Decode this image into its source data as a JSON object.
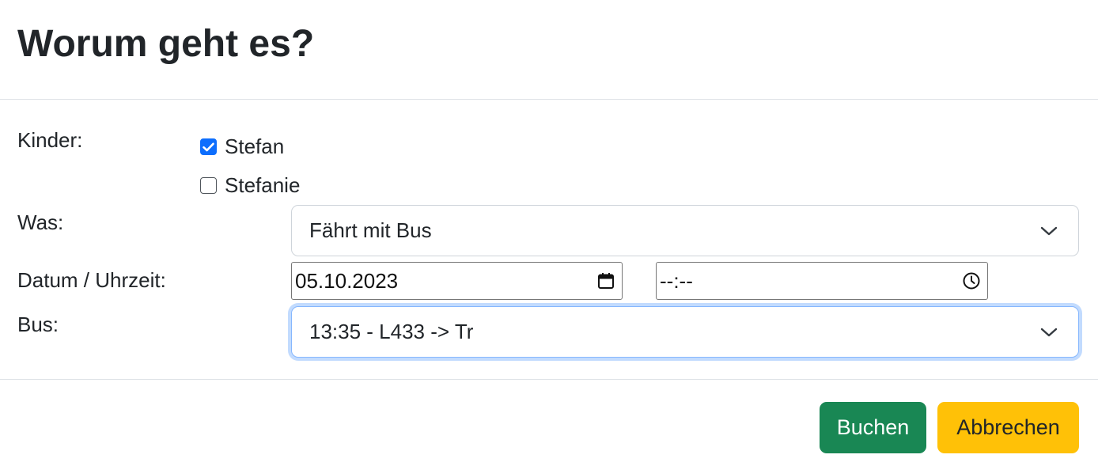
{
  "modal": {
    "title": "Worum geht es?"
  },
  "form": {
    "children": {
      "label": "Kinder:",
      "options": [
        {
          "label": "Stefan",
          "checked": true
        },
        {
          "label": "Stefanie",
          "checked": false
        }
      ]
    },
    "what": {
      "label": "Was:",
      "selected": "Fährt mit Bus"
    },
    "datetime": {
      "label": "Datum / Uhrzeit:",
      "date_value": "05.10.2023",
      "time_value": "--:--"
    },
    "bus": {
      "label": "Bus:",
      "selected": "13:35 - L433 -> Tr"
    }
  },
  "footer": {
    "book_label": "Buchen",
    "cancel_label": "Abbrechen"
  },
  "colors": {
    "primary": "#0d6efd",
    "success": "#198754",
    "warning": "#ffc107",
    "focus_ring": "#86b7fe"
  },
  "icons": {
    "checkbox_checked": "checkmark-icon",
    "select_chevron": "chevron-down-icon",
    "date_picker": "calendar-icon",
    "time_picker": "clock-icon"
  }
}
